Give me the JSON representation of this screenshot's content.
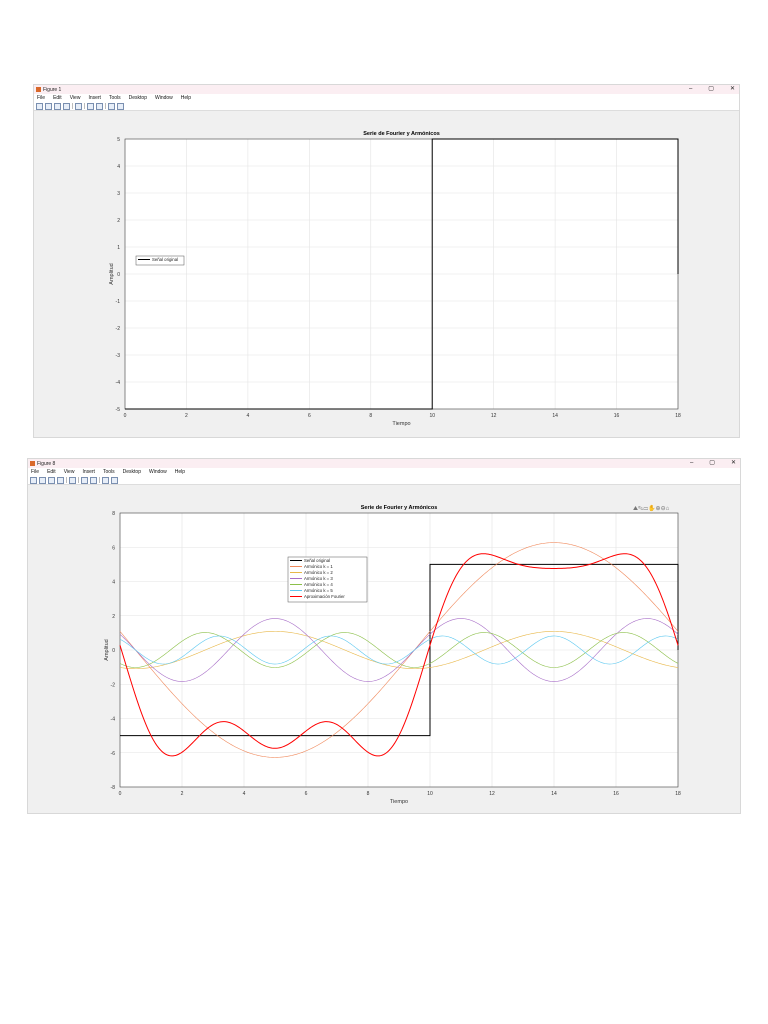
{
  "figures": [
    {
      "window_title": "Figure 1",
      "menu": [
        "File",
        "Edit",
        "View",
        "Insert",
        "Tools",
        "Desktop",
        "Window",
        "Help"
      ],
      "chart_data": {
        "type": "line",
        "title": "Serie de Fourier y Armónicos",
        "xlabel": "Tiempo",
        "ylabel": "Amplitud",
        "xlim": [
          0,
          18
        ],
        "ylim": [
          -5,
          5
        ],
        "xticks": [
          0,
          2,
          4,
          6,
          8,
          10,
          12,
          14,
          16,
          18
        ],
        "yticks": [
          -5,
          -4,
          -3,
          -2,
          -1,
          0,
          1,
          2,
          3,
          4,
          5
        ],
        "grid": true,
        "legend_position": "center-left",
        "signal": {
          "breakpoints": [
            0,
            10,
            18
          ],
          "levels": [
            -5,
            5
          ],
          "period": 18
        },
        "series": [
          {
            "name": "Señal original",
            "kind": "original",
            "color": "#000000"
          }
        ]
      }
    },
    {
      "window_title": "Figure 8",
      "menu": [
        "File",
        "Edit",
        "View",
        "Insert",
        "Tools",
        "Desktop",
        "Window",
        "Help"
      ],
      "chart_data": {
        "type": "line",
        "title": "Serie de Fourier y Armónicos",
        "xlabel": "Tiempo",
        "ylabel": "Amplitud",
        "xlim": [
          0,
          18
        ],
        "ylim": [
          -8,
          8
        ],
        "xticks": [
          0,
          2,
          4,
          6,
          8,
          10,
          12,
          14,
          16,
          18
        ],
        "yticks": [
          -8,
          -6,
          -4,
          -2,
          0,
          2,
          4,
          6,
          8
        ],
        "grid": true,
        "legend_position": "top-center",
        "signal": {
          "breakpoints": [
            0,
            10,
            18
          ],
          "levels": [
            -5,
            5
          ],
          "period": 18
        },
        "series": [
          {
            "name": "Señal original",
            "kind": "original",
            "color": "#000000"
          },
          {
            "name": "Armónico k = 1",
            "kind": "harmonic",
            "k": 1,
            "color": "#f08a5d"
          },
          {
            "name": "Armónico k = 2",
            "kind": "harmonic",
            "k": 2,
            "color": "#e8b84a"
          },
          {
            "name": "Armónico k = 3",
            "kind": "harmonic",
            "k": 3,
            "color": "#a86fc8"
          },
          {
            "name": "Armónico k = 4",
            "kind": "harmonic",
            "k": 4,
            "color": "#8cc04a"
          },
          {
            "name": "Armónico k = 5",
            "kind": "harmonic",
            "k": 5,
            "color": "#5cc8f0"
          },
          {
            "name": "Aproximación Fourier",
            "kind": "approx",
            "n": 5,
            "color": "#ff0000"
          }
        ]
      }
    }
  ]
}
